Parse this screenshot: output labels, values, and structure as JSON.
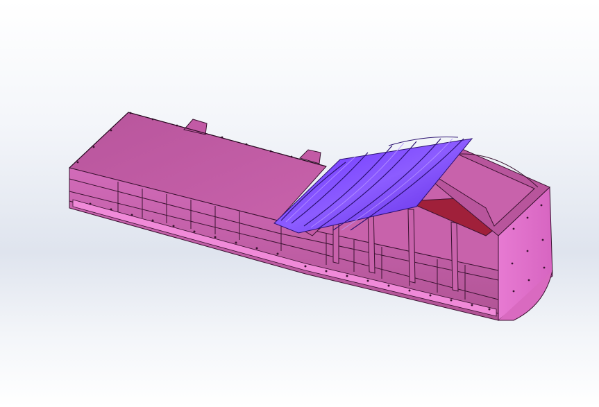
{
  "scene": {
    "subject": "cad-assembly",
    "render_style": "shaded-with-edges",
    "colors": {
      "body": "#c25aa5",
      "body_light": "#e070c8",
      "body_side": "#d96ac0",
      "edge": "#3a1230",
      "cover": "#7a3cff",
      "cover_light": "#a070ff",
      "interior_dark": "#a0203a",
      "bg_top": "#ffffff",
      "bg_mid": "#dfe4ee"
    }
  }
}
